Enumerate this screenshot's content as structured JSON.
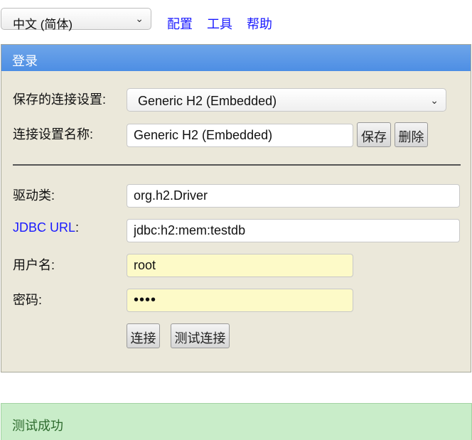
{
  "topbar": {
    "language": "中文 (简体)",
    "links": [
      "配置",
      "工具",
      "帮助"
    ]
  },
  "login": {
    "header": "登录",
    "saved_settings_label": "保存的连接设置:",
    "saved_settings_value": "Generic H2 (Embedded)",
    "setting_name_label": "连接设置名称:",
    "setting_name_value": "Generic H2 (Embedded)",
    "save_button": "保存",
    "delete_button": "删除",
    "driver_label": "驱动类:",
    "driver_value": "org.h2.Driver",
    "jdbc_link": "JDBC URL",
    "jdbc_colon": ":",
    "jdbc_value": "jdbc:h2:mem:testdb",
    "user_label": "用户名:",
    "user_value": "root",
    "password_label": "密码:",
    "password_value": "••••",
    "connect_button": "连接",
    "test_button": "测试连接"
  },
  "status": {
    "message": "测试成功"
  },
  "colors": {
    "header_blue": "#5b97e6",
    "panel_bg": "#ebe8da",
    "link_blue": "#1a1aff",
    "success_bg": "#c9edc9",
    "success_text": "#2d6a2d",
    "input_yellow": "#fdfac8"
  }
}
